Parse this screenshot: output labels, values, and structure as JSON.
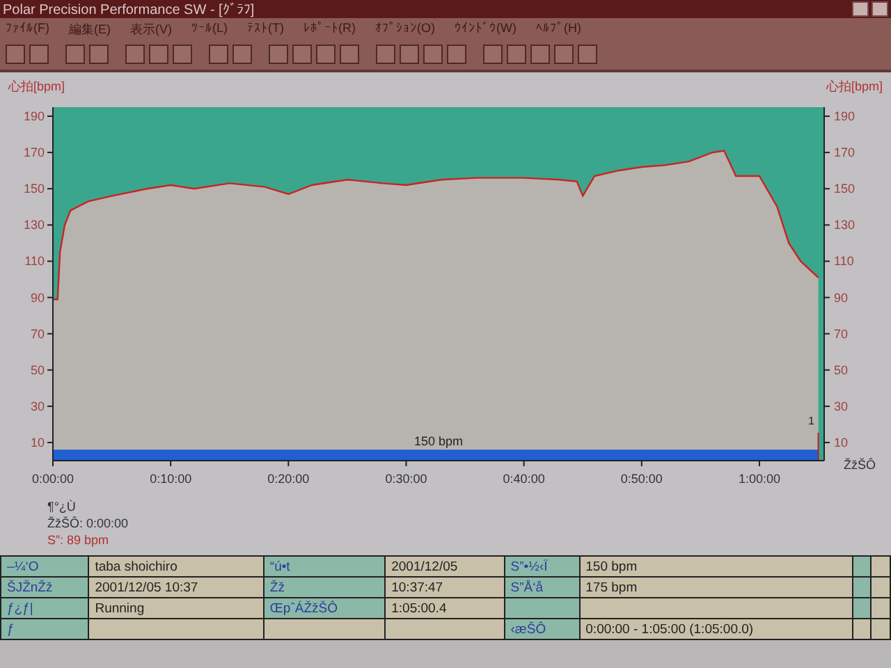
{
  "window": {
    "title": "Polar Precision Performance SW - [ｸﾞﾗﾌ]"
  },
  "menu": [
    "ﾌｧｲﾙ(F)",
    "編集(E)",
    "表示(V)",
    "ﾂｰﾙ(L)",
    "ﾃｽﾄ(T)",
    "ﾚﾎﾟｰﾄ(R)",
    "ｵﾌﾟｼｮﾝ(O)",
    "ｳｲﾝﾄﾞｳ(W)",
    "ﾍﾙﾌﾟ(H)"
  ],
  "chart": {
    "band_label": "150 bpm",
    "right_axis_title": "心拍[bpm]",
    "right_axis_ticks": [
      "190",
      "170",
      "150",
      "130",
      "110",
      "90",
      "70",
      "50",
      "30",
      "10"
    ],
    "time_axis_label": "ŽžŠÔ",
    "marker_label": "1",
    "chart_data": {
      "type": "area",
      "ylabel": "心拍[bpm]",
      "xlim": [
        0,
        65.5
      ],
      "ylim": [
        0,
        195
      ],
      "x": [
        0,
        0.4,
        0.6,
        1,
        1.5,
        3,
        5,
        8,
        10,
        12,
        15,
        18,
        20,
        22,
        25,
        28,
        30,
        33,
        36,
        40,
        43,
        44.5,
        45,
        46,
        48,
        50,
        52,
        54,
        56,
        57,
        58,
        60,
        61.5,
        62.5,
        63.5,
        64.5,
        65
      ],
      "series": [
        {
          "color": "#cc2222",
          "values": [
            89,
            89,
            115,
            130,
            138,
            143,
            146,
            150,
            152,
            150,
            153,
            151,
            147,
            152,
            155,
            153,
            152,
            155,
            156,
            156,
            155,
            154,
            146,
            157,
            160,
            162,
            163,
            165,
            170,
            171,
            157,
            157,
            140,
            120,
            110,
            104,
            101
          ]
        }
      ],
      "yticks": [
        10,
        30,
        50,
        70,
        90,
        110,
        130,
        150,
        170,
        190
      ],
      "xticks": [
        {
          "value": 0,
          "label": "0:00:00"
        },
        {
          "value": 10,
          "label": "0:10:00"
        },
        {
          "value": 20,
          "label": "0:20:00"
        },
        {
          "value": 30,
          "label": "0:30:00"
        },
        {
          "value": 40,
          "label": "0:40:00"
        },
        {
          "value": 50,
          "label": "0:50:00"
        },
        {
          "value": 60,
          "label": "1:00:00"
        }
      ]
    }
  },
  "cursor_info": [
    {
      "text": "¶°¿Ù",
      "kind": "plain"
    },
    {
      "text": "ŽžŠÔ: 0:00:00",
      "kind": "plain"
    },
    {
      "text": "S”: 89 bpm",
      "kind": "heart"
    }
  ],
  "table": {
    "rows": [
      [
        {
          "kind": "label",
          "text": "–¼‘O"
        },
        {
          "kind": "value",
          "text": "taba shoichiro"
        },
        {
          "kind": "label",
          "text": "“ú•t"
        },
        {
          "kind": "value",
          "text": "2001/12/05"
        },
        {
          "kind": "label",
          "text": "S”•½‹Ï"
        },
        {
          "kind": "value",
          "text": "150 bpm"
        },
        {
          "kind": "label"
        },
        {
          "kind": "value"
        }
      ],
      [
        {
          "kind": "label",
          "text": "ŠJŽnŽž"
        },
        {
          "kind": "value",
          "text": "2001/12/05 10:37"
        },
        {
          "kind": "label",
          "text": "Žž"
        },
        {
          "kind": "value",
          "text": "10:37:47"
        },
        {
          "kind": "label",
          "text": "S”Å‘å"
        },
        {
          "kind": "value",
          "text": "175 bpm"
        },
        {
          "kind": "label"
        },
        {
          "kind": "value"
        }
      ],
      [
        {
          "kind": "label",
          "text": "ƒ¿ƒ|"
        },
        {
          "kind": "value",
          "text": "Running"
        },
        {
          "kind": "label",
          "text": "ŒpˆÁŽžŠÔ"
        },
        {
          "kind": "value",
          "text": "1:05:00.4"
        },
        {
          "kind": "label"
        },
        {
          "kind": "value"
        },
        {
          "kind": "label"
        },
        {
          "kind": "value"
        }
      ],
      [
        {
          "kind": "label",
          "text": "ƒ"
        },
        {
          "kind": "value"
        },
        {
          "kind": "value"
        },
        {
          "kind": "value"
        },
        {
          "kind": "label",
          "text": "‹æŠÔ"
        },
        {
          "kind": "value",
          "text": "0:00:00 - 1:05:00 (1:05:00.0)"
        },
        {
          "kind": "value"
        },
        {
          "kind": "value"
        }
      ]
    ]
  }
}
